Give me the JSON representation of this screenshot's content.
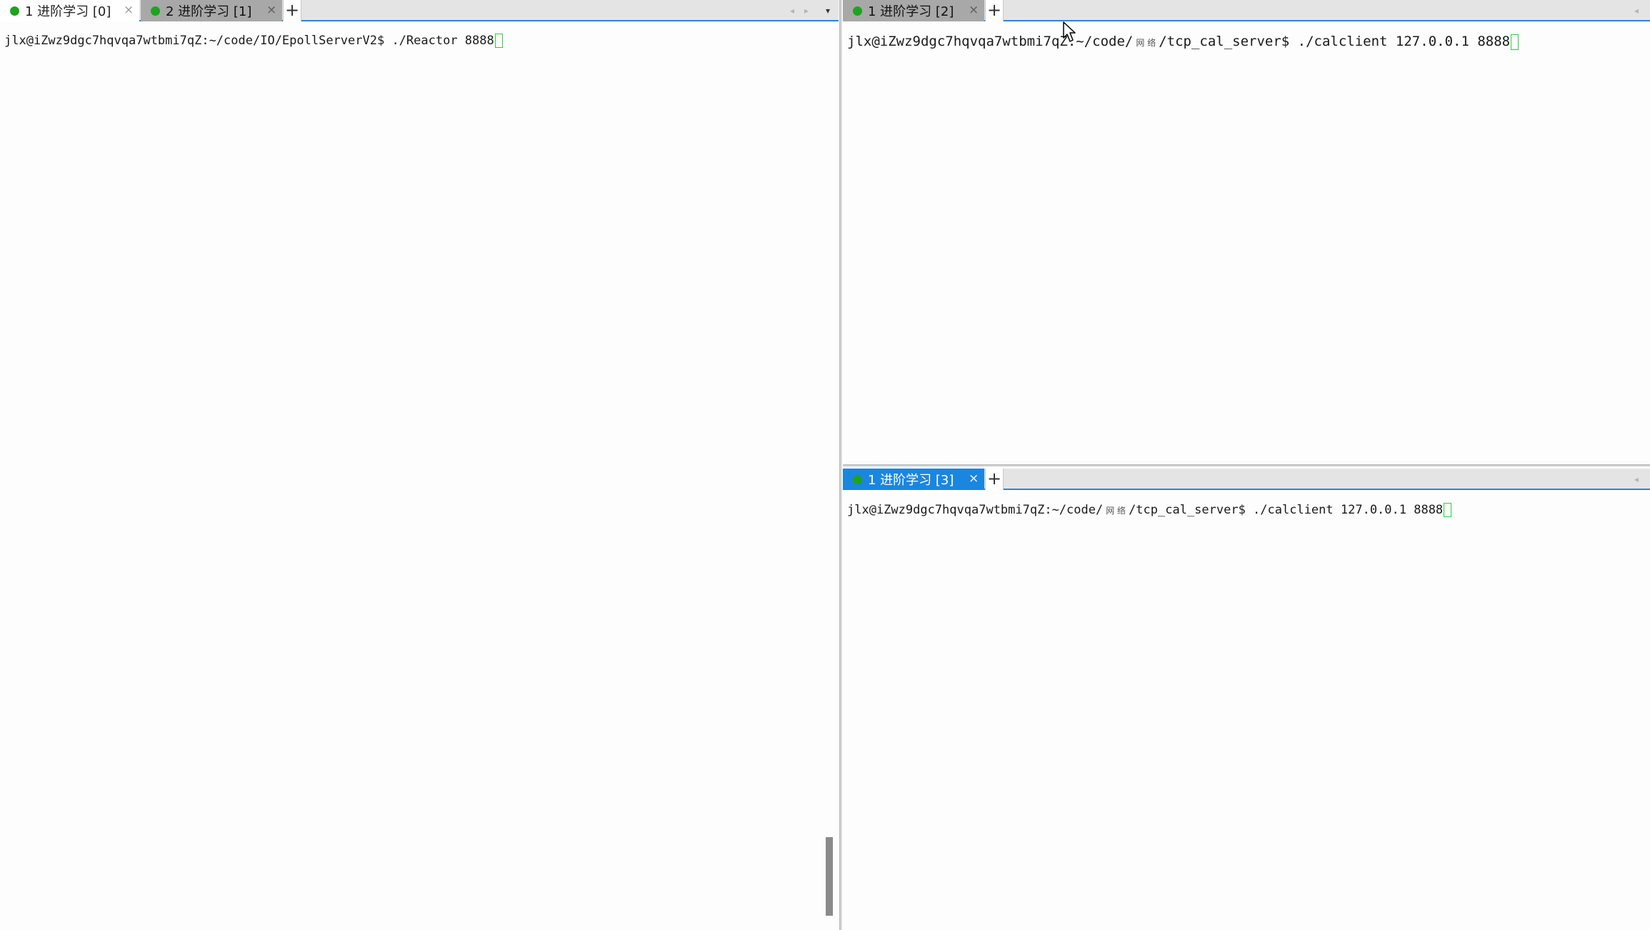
{
  "left_pane": {
    "tabs": [
      {
        "label": "1 进阶学习 [0]",
        "close": "×"
      },
      {
        "label": "2 进阶学习 [1]",
        "close": "×"
      }
    ],
    "add_tab": "+",
    "nav_prev": "◂",
    "nav_next": "▸",
    "menu_arrow": "▾",
    "terminal": {
      "prompt": "jlx@iZwz9dgc7hqvqa7wtbmi7qZ:~/code/IO/EpollServerV2$ ./Reactor 8888"
    }
  },
  "right_top_pane": {
    "tabs": [
      {
        "label": "1 进阶学习 [2]",
        "close": "×"
      }
    ],
    "add_tab": "+",
    "nav_prev": "◂",
    "terminal": {
      "prompt_before": "jlx@iZwz9dgc7hqvqa7wtbmi7qZ:~/code/",
      "garbled": "网 络",
      "prompt_after": "/tcp_cal_server$ ./calclient 127.0.0.1 8888"
    }
  },
  "right_bottom_pane": {
    "tabs": [
      {
        "label": "1 进阶学习 [3]",
        "close": "×"
      }
    ],
    "add_tab": "+",
    "nav_prev": "◂",
    "terminal": {
      "prompt_before": "jlx@iZwz9dgc7hqvqa7wtbmi7qZ:~/code/",
      "garbled": "网 络",
      "prompt_after": "/tcp_cal_server$ ./calclient 127.0.0.1 8888"
    }
  },
  "colors": {
    "accent": "#1a86e0",
    "status_dot": "#1fa31f",
    "cursor": "#2fcf3a",
    "tab_inactive": "#a8a8a8",
    "terminal_bg": "#fdfdfd"
  }
}
